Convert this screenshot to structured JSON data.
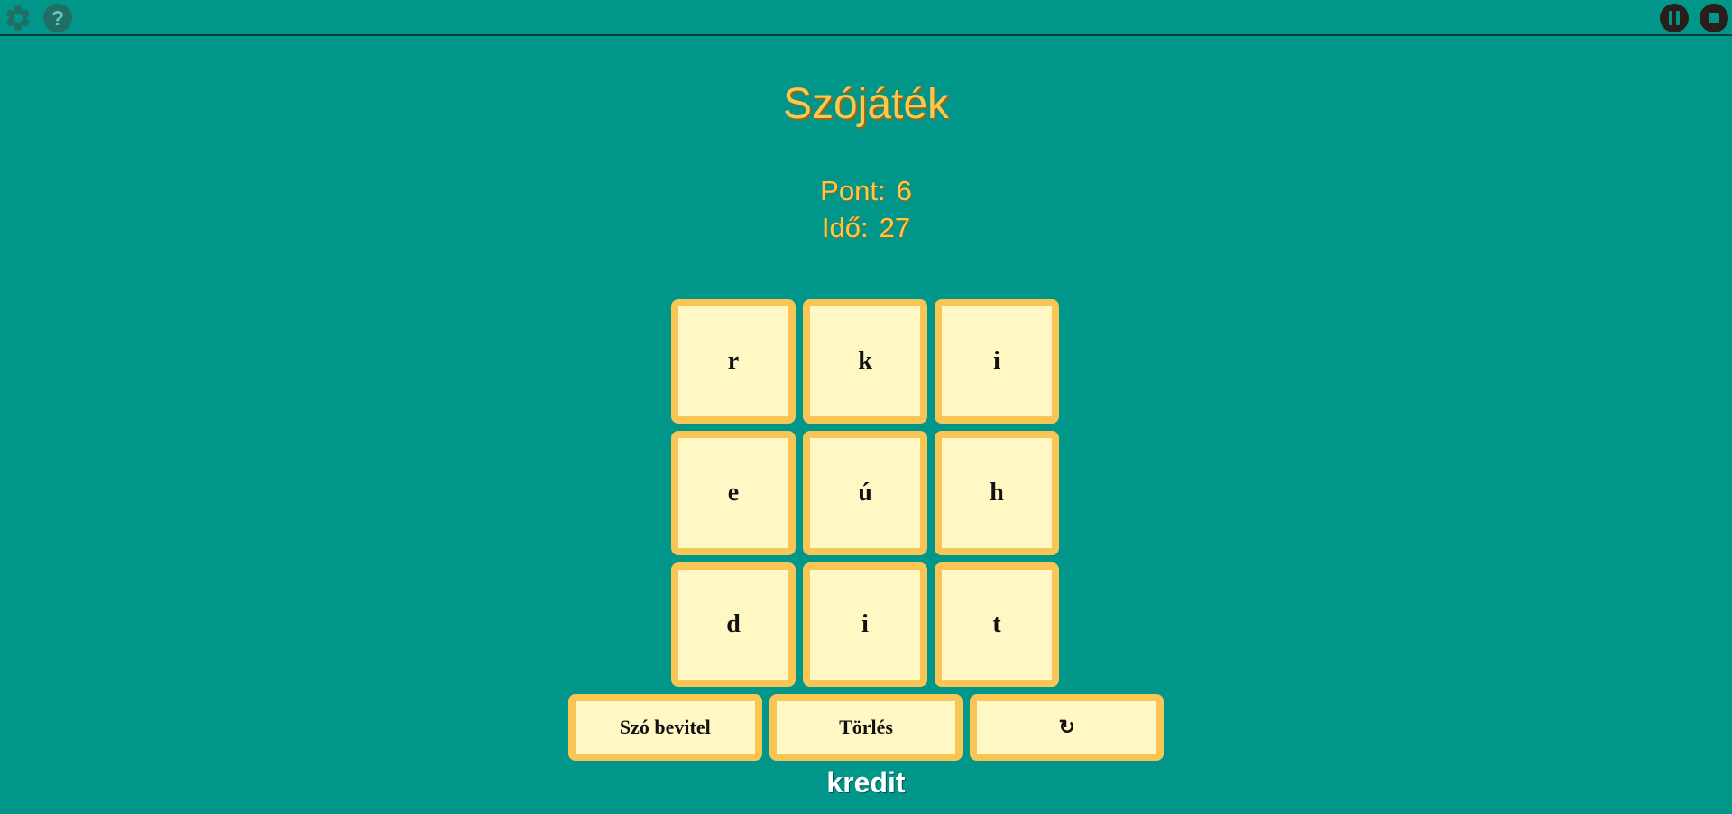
{
  "toolbar": {
    "settings_icon": "gear-icon",
    "help_icon": "question-icon",
    "pause_icon": "pause-icon",
    "stop_icon": "stop-icon",
    "colors": {
      "icon_dim": "#1f6f66",
      "icon_dark": "#2a1d1a"
    }
  },
  "game": {
    "title": "Szójáték",
    "score_label": "Pont:",
    "score_value": "6",
    "time_label": "Idő:",
    "time_value": "27",
    "tiles": [
      "r",
      "k",
      "i",
      "e",
      "ú",
      "h",
      "d",
      "i",
      "t"
    ],
    "buttons": {
      "submit": "Szó bevitel",
      "clear": "Törlés",
      "reset": "↻"
    },
    "credit_label": "kredit",
    "colors": {
      "background": "#00978a",
      "accent": "#fcc74a",
      "tile_fill": "#fff8c5",
      "tile_border": "#f9c554"
    }
  }
}
